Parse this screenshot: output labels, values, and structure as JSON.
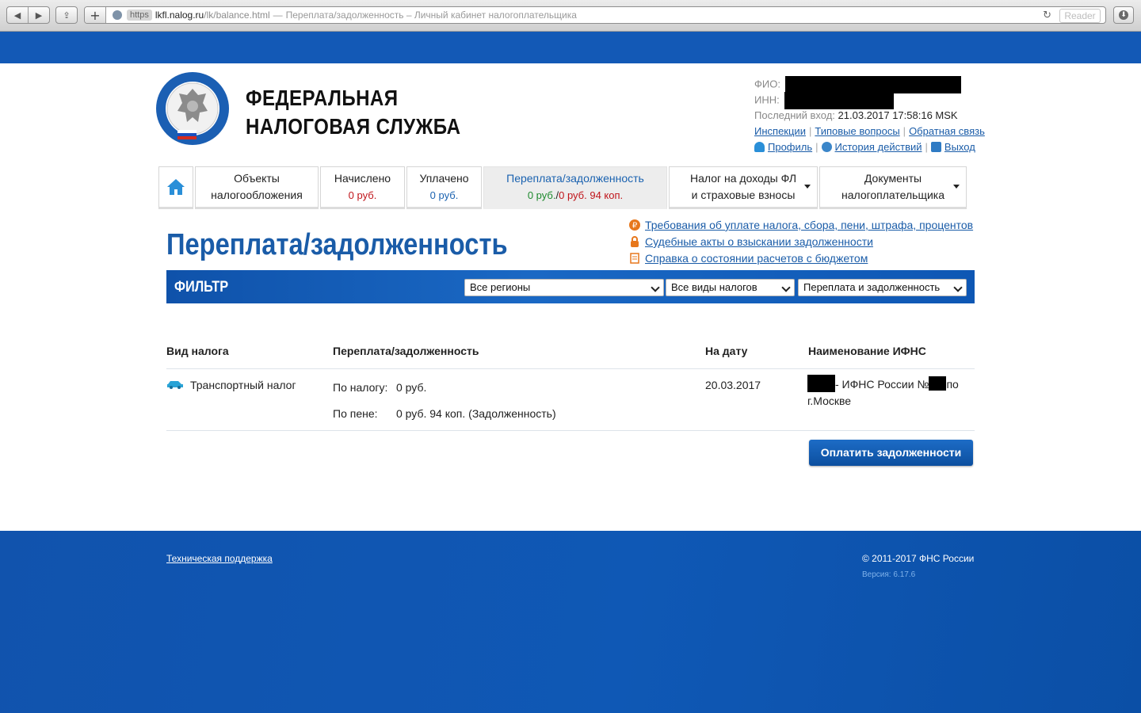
{
  "browser": {
    "https_label": "https",
    "url_host": "lkfl.nalog.ru",
    "url_path": "/lk/balance.html",
    "url_separator": "—",
    "page_title": "Переплата/задолженность – Личный кабинет налогоплательщика",
    "reader_label": "Reader"
  },
  "header": {
    "agency_line1": "ФЕДЕРАЛЬНАЯ",
    "agency_line2": "НАЛОГОВАЯ СЛУЖБА",
    "fio_label": "ФИО:",
    "inn_label": "ИНН:",
    "last_login_label": "Последний вход:",
    "last_login_value": "21.03.2017 17:58:16 MSK",
    "links": [
      "Инспекции",
      "Типовые вопросы",
      "Обратная связь"
    ],
    "profile_label": "Профиль",
    "history_label": "История действий",
    "logout_label": "Выход"
  },
  "tabs": [
    {
      "line1": "Объекты",
      "line2": "налогообложения"
    },
    {
      "line1": "Начислено",
      "line2": "0 руб."
    },
    {
      "line1": "Уплачено",
      "line2": "0 руб."
    },
    {
      "line1": "Переплата/задолженность",
      "line2a": "0 руб.",
      "line2sep": "/",
      "line2b": "0 руб. 94 коп."
    },
    {
      "line1": "Налог на доходы ФЛ",
      "line2": "и страховые взносы"
    },
    {
      "line1": "Документы",
      "line2": "налогоплательщика"
    }
  ],
  "page": {
    "title": "Переплата/задолженность",
    "quick_links": [
      "Требования об уплате налога, сбора, пени, штрафа, процентов",
      "Судебные акты о взыскании задолженности",
      "Справка о состоянии расчетов с бюджетом"
    ]
  },
  "filter": {
    "label": "ФИЛЬТР",
    "region": "Все регионы",
    "tax_type": "Все виды налогов",
    "balance_type": "Переплата и задолженность"
  },
  "table": {
    "headers": [
      "Вид налога",
      "Переплата/задолженность",
      "На дату",
      "Наименование ИФНС"
    ],
    "row": {
      "tax_name": "Транспортный налог",
      "by_tax_label": "По налогу:",
      "by_tax_value": "0 руб.",
      "by_penalty_label": "По пене:",
      "by_penalty_value": "0 руб. 94 коп. (Задолженность)",
      "date": "20.03.2017",
      "ifns_part1": "- ИФНС России №",
      "ifns_part2": "по",
      "ifns_part3": "г.Москве"
    },
    "pay_button": "Оплатить задолженности"
  },
  "footer": {
    "support": "Техническая поддержка",
    "copyright": "© 2011-2017 ФНС России",
    "version": "Версия: 6.17.6"
  },
  "colors": {
    "brand_blue": "#1359b6",
    "link_blue": "#1a5ca8",
    "positive_green": "#1e8a2e",
    "debt_red": "#c0151b"
  }
}
